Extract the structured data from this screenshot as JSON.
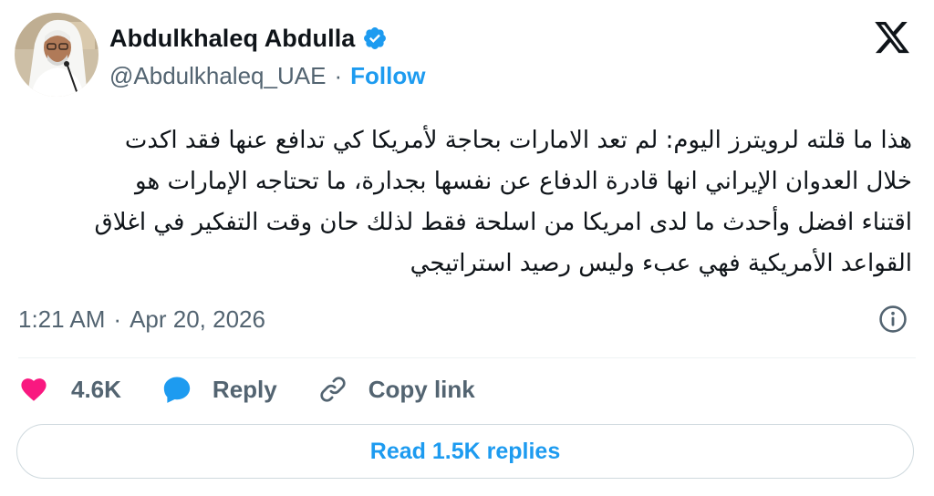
{
  "author": {
    "name": "Abdulkhaleq Abdulla",
    "handle": "@Abdulkhaleq_UAE",
    "separator": "·",
    "follow_label": "Follow"
  },
  "tweet": {
    "lines": [
      "هذا ما قلته لرويترز اليوم: لم تعد الامارات بحاجة لأمريكا كي تدافع عنها فقد اكدت",
      "خلال العدوان الإيراني انها قادرة الدفاع عن نفسها بجدارة، ما تحتاجه الإمارات هو",
      "اقتناء افضل وأحدث ما لدى امريكا من اسلحة فقط لذلك حان وقت التفكير في اغلاق",
      "القواعد الأمريكية فهي عبء وليس رصيد استراتيجي"
    ]
  },
  "meta": {
    "time": "1:21 AM",
    "separator": "·",
    "date": "Apr 20, 2026"
  },
  "actions": {
    "likes": "4.6K",
    "reply_label": "Reply",
    "copy_link_label": "Copy link"
  },
  "replies_button": {
    "label": "Read 1.5K replies"
  },
  "colors": {
    "accent": "#1d9bf0",
    "like": "#f91880",
    "secondary_text": "#536471",
    "border": "#cfd9de"
  },
  "icons": [
    "verified-badge-icon",
    "x-logo-icon",
    "info-icon",
    "heart-icon",
    "reply-bubble-icon",
    "link-icon"
  ]
}
